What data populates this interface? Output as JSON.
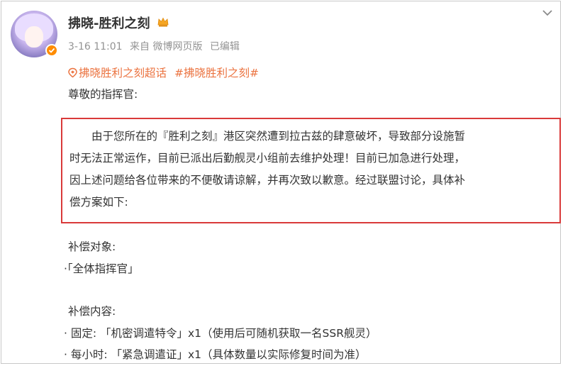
{
  "post": {
    "author_name": "拂晓-胜利之刻",
    "timestamp": "3-16 11:01",
    "source": "来自 微博网页版",
    "edited": "已编辑",
    "tags": [
      "拂晓胜利之刻超话",
      "#拂晓胜利之刻#"
    ],
    "greeting": "尊敬的指挥官:",
    "notice_lines": [
      "　　由于您所在的『胜利之刻』港区突然遭到拉古兹的肆意破坏，导致部分设施暂",
      "时无法正常运作，目前已派出后勤舰灵小组前去维护处理！目前已加急进行处理，",
      "因上述问题给各位带来的不便敬请谅解，并再次致以歉意。经过联盟讨论，具体补",
      "偿方案如下:"
    ],
    "compensation_target_title": "补偿对象:",
    "compensation_target_item": "·「全体指挥官」",
    "compensation_content_title": "补偿内容:",
    "compensation_items": [
      "· 固定: 「机密调遣特令」x1（使用后可随机获取一名SSR舰灵）",
      "· 每小时: 「紧急调遣证」x1（具体数量以实际修复时间为准）"
    ]
  },
  "colors": {
    "tag": "#eb7340",
    "meta": "#939393",
    "highlight_border": "#d93a3a",
    "verified_badge": "#ff8c00"
  },
  "icons": [
    "verified-badge-icon",
    "crown-icon",
    "chevron-down-icon",
    "super-topic-icon"
  ]
}
